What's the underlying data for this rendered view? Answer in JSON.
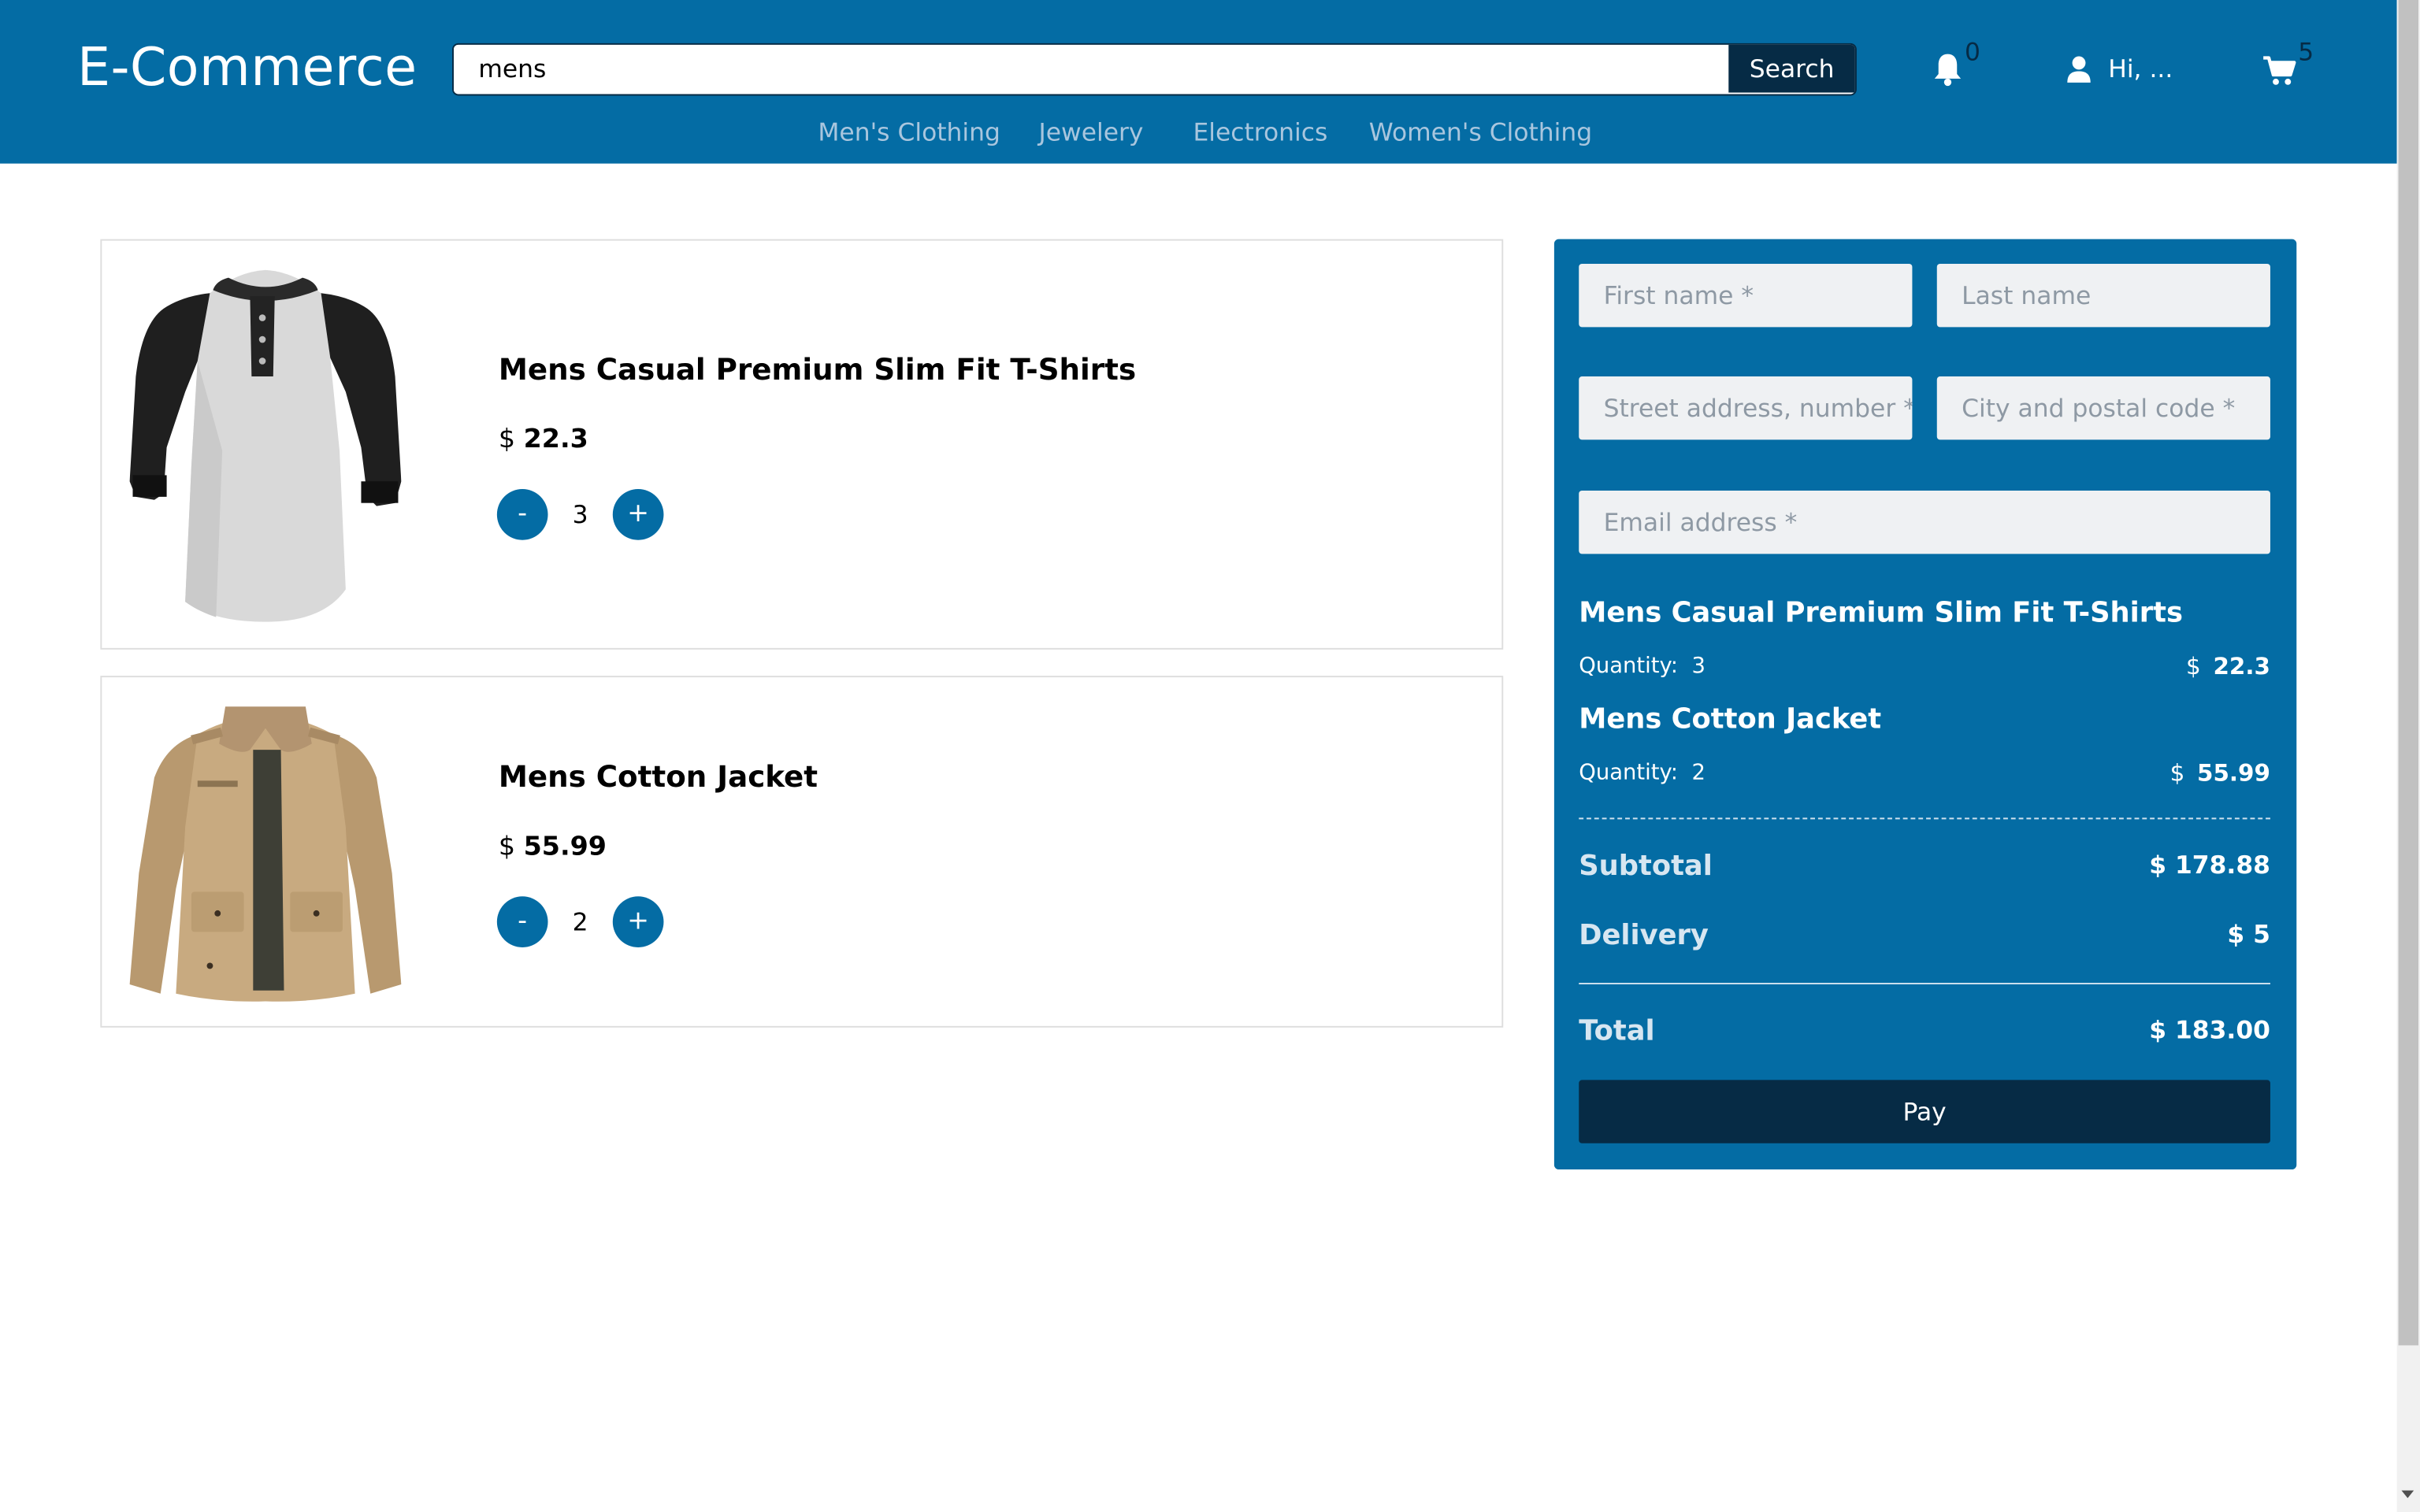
{
  "header": {
    "logo": "E-Commerce",
    "search": {
      "value": "mens",
      "button_label": "Search"
    },
    "notifications_count": "0",
    "greeting": "Hi, ...",
    "cart_count": "5",
    "nav": [
      "Men's Clothing",
      "Jewelery",
      "Electronics",
      "Women's Clothing"
    ]
  },
  "colors": {
    "primary": "#046ca4",
    "dark": "#062b45",
    "field_bg": "#eff1f3"
  },
  "cart": {
    "items": [
      {
        "name": "Mens Casual Premium Slim Fit T-Shirts",
        "currency": "$",
        "price": "22.3",
        "quantity": "3",
        "minus_label": "-",
        "plus_label": "+"
      },
      {
        "name": "Mens Cotton Jacket",
        "currency": "$",
        "price": "55.99",
        "quantity": "2",
        "minus_label": "-",
        "plus_label": "+"
      }
    ]
  },
  "checkout": {
    "placeholders": {
      "first_name": "First name *",
      "last_name": "Last name",
      "street": "Street address, number *",
      "city": "City and postal code *",
      "email": "Email address *"
    },
    "summary": [
      {
        "name": "Mens Casual Premium Slim Fit T-Shirts",
        "qty_label": "Quantity:",
        "qty": "3",
        "currency": "$",
        "price": "22.3"
      },
      {
        "name": "Mens Cotton Jacket",
        "qty_label": "Quantity:",
        "qty": "2",
        "currency": "$",
        "price": "55.99"
      }
    ],
    "subtotal_label": "Subtotal",
    "subtotal_value": "$ 178.88",
    "delivery_label": "Delivery",
    "delivery_value": "$ 5",
    "total_label": "Total",
    "total_value": "$ 183.00",
    "pay_label": "Pay"
  }
}
